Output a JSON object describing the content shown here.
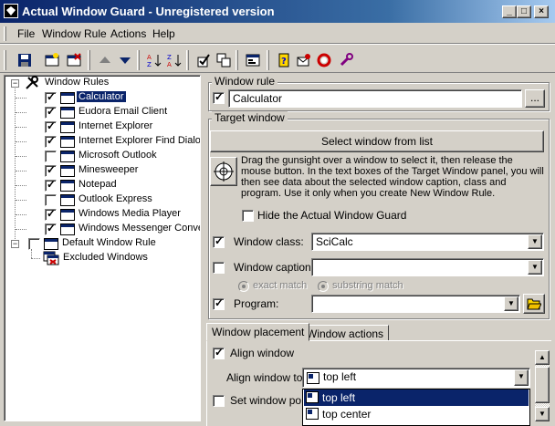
{
  "window": {
    "title": "Actual Window Guard - Unregistered version",
    "controls": {
      "minimize": "_",
      "maximize": "□",
      "close": "×"
    }
  },
  "menu": [
    "File",
    "Window Rule",
    "Actions",
    "Help"
  ],
  "toolbar": {
    "icons": [
      "save-icon",
      "new-rule-icon",
      "delete-rule-icon",
      "move-up-icon",
      "move-down-icon",
      "sort-az-icon",
      "sort-za-icon",
      "check-all-icon",
      "copy-rule-icon",
      "properties-icon",
      "help-icon",
      "email-icon",
      "support-icon",
      "register-icon"
    ]
  },
  "tree": {
    "root_label": "Window Rules",
    "items": [
      {
        "label": "Calculator",
        "checked": true,
        "selected": true
      },
      {
        "label": "Eudora Email Client",
        "checked": true
      },
      {
        "label": "Internet Explorer",
        "checked": true
      },
      {
        "label": "Internet Explorer Find Dialog",
        "checked": true
      },
      {
        "label": "Microsoft Outlook",
        "checked": false
      },
      {
        "label": "Minesweeper",
        "checked": true
      },
      {
        "label": "Notepad",
        "checked": true
      },
      {
        "label": "Outlook Express",
        "checked": false
      },
      {
        "label": "Windows Media Player",
        "checked": true
      },
      {
        "label": "Windows Messenger Conversation",
        "checked": true
      }
    ],
    "default_rule": "Default Window Rule",
    "excluded": "Excluded Windows"
  },
  "window_rule": {
    "group_title": "Window rule",
    "name_value": "Calculator",
    "browse_label": "..."
  },
  "target_window": {
    "group_title": "Target window",
    "select_button": "Select window from list",
    "instructions": "Drag the gunsight over a window to select it, then release the mouse button. In the text boxes of the Target Window panel, you will then see data about the selected window caption, class and program. Use it only when you create New Window Rule.",
    "hide_label": "Hide the Actual Window Guard",
    "class_label": "Window class:",
    "class_value": "SciCalc",
    "caption_label": "Window caption:",
    "caption_value": "",
    "exact_match": "exact match",
    "substring_match": "substring match",
    "program_label": "Program:",
    "program_value": ""
  },
  "tabs": {
    "placement": "Window placement",
    "actions": "Window actions"
  },
  "placement": {
    "align_window": "Align window",
    "align_to_label": "Align window to:",
    "align_to_value": "top left",
    "set_position": "Set window position",
    "dropdown_options": [
      "top left",
      "top center"
    ]
  },
  "colors": {
    "face": "#d4d0c8",
    "selection": "#0a246a",
    "title_start": "#0a246a",
    "title_end": "#a6caf0"
  }
}
